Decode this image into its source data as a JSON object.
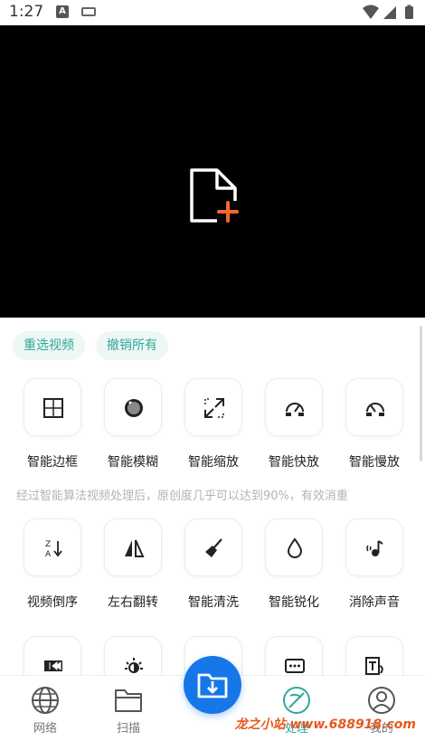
{
  "status_bar": {
    "time": "1:27",
    "notification_letter": "A"
  },
  "video_area": {
    "icon": "file-add-icon",
    "accent_color": "#f4692a"
  },
  "actions": {
    "reselect_video": "重选视频",
    "undo_all": "撤销所有"
  },
  "tools": [
    {
      "label": "智能边框",
      "icon": "border-grid-icon"
    },
    {
      "label": "智能模糊",
      "icon": "blur-lens-icon"
    },
    {
      "label": "智能缩放",
      "icon": "zoom-arrows-icon"
    },
    {
      "label": "智能快放",
      "icon": "fast-speed-icon"
    },
    {
      "label": "智能慢放",
      "icon": "slow-speed-icon"
    },
    {
      "label": "视频倒序",
      "icon": "reverse-order-icon"
    },
    {
      "label": "左右翻转",
      "icon": "flip-horizontal-icon"
    },
    {
      "label": "智能清洗",
      "icon": "broom-icon"
    },
    {
      "label": "智能锐化",
      "icon": "water-drop-icon"
    },
    {
      "label": "消除声音",
      "icon": "mute-sound-icon"
    },
    {
      "label": "",
      "icon": "rewind-icon"
    },
    {
      "label": "",
      "icon": "brightness-icon"
    },
    {
      "label": "",
      "icon": "blank-icon"
    },
    {
      "label": "",
      "icon": "subtitle-icon"
    },
    {
      "label": "",
      "icon": "text-image-icon"
    }
  ],
  "description": "经过智能算法视频处理后，原创度几乎可以达到90%，有效消重",
  "bottom_nav": [
    {
      "label": "网络",
      "icon": "globe-icon"
    },
    {
      "label": "扫描",
      "icon": "folder-icon"
    },
    {
      "label": "",
      "icon": "download-folder-icon"
    },
    {
      "label": "处理",
      "icon": "process-icon"
    },
    {
      "label": "我的",
      "icon": "user-icon"
    }
  ],
  "watermark": "龙之小站 www.688918.com",
  "colors": {
    "accent_teal": "#2fa89a",
    "fab_blue": "#1677e8",
    "watermark_orange": "#e8571c"
  }
}
